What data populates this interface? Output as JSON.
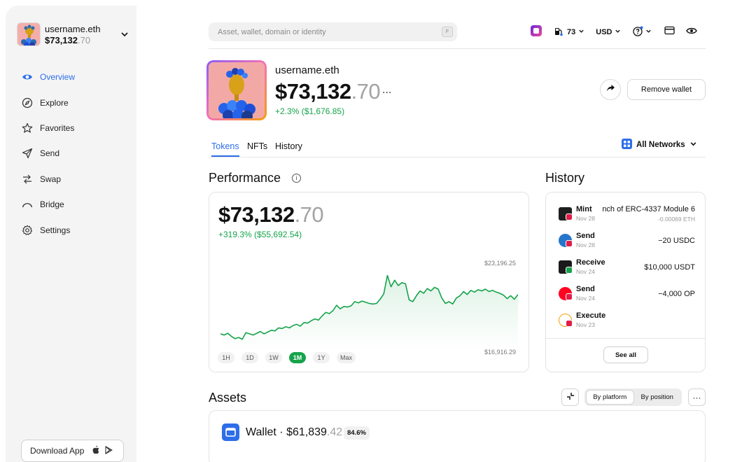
{
  "account": {
    "name": "username.eth",
    "balance_main": "$73,132",
    "balance_dec": ".70"
  },
  "nav": {
    "items": [
      {
        "label": "Overview",
        "icon": "eye-icon",
        "active": true
      },
      {
        "label": "Explore",
        "icon": "compass-icon"
      },
      {
        "label": "Favorites",
        "icon": "star-icon"
      },
      {
        "label": "Send",
        "icon": "send-icon"
      },
      {
        "label": "Swap",
        "icon": "swap-icon"
      },
      {
        "label": "Bridge",
        "icon": "bridge-icon"
      },
      {
        "label": "Settings",
        "icon": "gear-icon"
      }
    ]
  },
  "download": {
    "label": "Download App"
  },
  "search": {
    "placeholder": "Asset, wallet, domain or identity",
    "shortcut": "F"
  },
  "topbar": {
    "gas": "73",
    "currency": "USD"
  },
  "profile": {
    "name": "username.eth",
    "balance_main": "$73,132",
    "balance_dec": ".70",
    "more": "...",
    "change": "+2.3% ($1,676.85)",
    "remove_label": "Remove wallet"
  },
  "tabs": [
    {
      "label": "Tokens",
      "active": true
    },
    {
      "label": "NFTs"
    },
    {
      "label": "History"
    }
  ],
  "networks": {
    "label": "All Networks"
  },
  "performance": {
    "heading": "Performance",
    "balance_main": "$73,132",
    "balance_dec": ".70",
    "change": "+319.3% ($55,692.54)",
    "max_label": "$23,196.25",
    "min_label": "$16,916.29",
    "ranges": [
      "1H",
      "1D",
      "1W",
      "1M",
      "1Y",
      "Max"
    ],
    "active_range": "1M",
    "line_color": "#16a34a"
  },
  "chart_data": {
    "type": "area",
    "ylim": [
      16916.29,
      23196.25
    ],
    "values": [
      17800,
      17700,
      17850,
      17600,
      17400,
      17500,
      17350,
      17900,
      17800,
      17700,
      17850,
      18000,
      17800,
      17950,
      18100,
      18050,
      18300,
      18250,
      18400,
      18300,
      18500,
      18600,
      18450,
      18750,
      18700,
      18900,
      19050,
      18950,
      19300,
      19600,
      19500,
      19750,
      20200,
      19900,
      20100,
      20050,
      20150,
      20500,
      20400,
      20550,
      20450,
      20350,
      20300,
      20350,
      20700,
      21150,
      22700,
      21750,
      22300,
      21850,
      22100,
      22000,
      20650,
      20500,
      21000,
      21400,
      21200,
      21600,
      21400,
      21700,
      21550,
      20800,
      20350,
      20500,
      20300,
      20800,
      21000,
      21350,
      21100,
      21450,
      21300,
      21500,
      21400,
      21550,
      21350,
      21450,
      21300,
      21200,
      21050,
      20750,
      21000,
      20700,
      21100
    ]
  },
  "history": {
    "heading": "History",
    "see_all": "See all",
    "items": [
      {
        "type": "Mint",
        "date": "Nov 28",
        "amount": "nch of ERC-4337 Module 6",
        "sub": "-0.00069 ETH"
      },
      {
        "type": "Send",
        "date": "Nov 28",
        "amount": "−20 USDC"
      },
      {
        "type": "Receive",
        "date": "Nov 24",
        "amount": "$10,000 USDT"
      },
      {
        "type": "Send",
        "date": "Nov 24",
        "amount": "−4,000 OP"
      },
      {
        "type": "Execute",
        "date": "Nov 23",
        "amount": ""
      }
    ]
  },
  "assets": {
    "heading": "Assets",
    "by_platform": "By platform",
    "by_position": "By position",
    "more": "···",
    "wallet_label": "Wallet · $61,839",
    "wallet_dec": ".42",
    "wallet_pct": "84.6%"
  },
  "colors": {
    "accent": "#2e6ee8",
    "positive": "#16a34a"
  }
}
